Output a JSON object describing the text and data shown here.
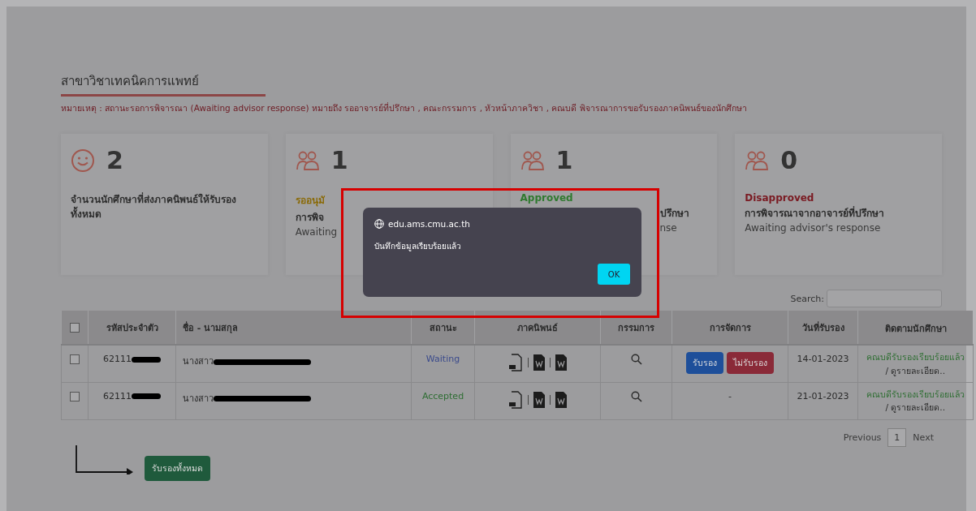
{
  "page": {
    "title": "สาขาวิชาเทคนิคการแพทย์",
    "note": "หมายเหตุ : สถานะรอการพิจารณา (Awaiting advisor response) หมายถึง รออาจารย์ที่ปรึกษา , คณะกรรมการ , หัวหน้าภาควิชา , คณบดี พิจารณาการขอรับรองภาคนิพนธ์ของนักศึกษา"
  },
  "cards": [
    {
      "kind": "smiley",
      "count": "2",
      "description": "จำนวนนักศึกษาที่ส่งภาคนิพนธ์ให้รับรองทั้งหมด"
    },
    {
      "kind": "people",
      "count": "1",
      "label": "รออนุมั",
      "color": "#8a6a08",
      "line_1": "การพิจ",
      "line_2": "Awaiting",
      "hidden_right": true
    },
    {
      "kind": "people",
      "count": "1",
      "label": "Approved",
      "color": "#2f7a2f",
      "line_1": "ปรึกษา",
      "line_2": "nse",
      "hidden_left": true
    },
    {
      "kind": "people",
      "count": "0",
      "label": "Disapproved",
      "color": "#7a1a22",
      "line_1": "การพิจารณาจากอาจารย์ที่ปรึกษา",
      "line_2": "Awaiting advisor's response"
    }
  ],
  "search": {
    "label": "Search:"
  },
  "table": {
    "select_all_checked": false,
    "columns": [
      "รหัสประจำตัว",
      "ชื่อ - นามสกุล",
      "สถานะ",
      "ภาคนิพนธ์",
      "กรรมการ",
      "การจัดการ",
      "วันที่รับรอง",
      "ติดตามนักศึกษา"
    ],
    "rows": [
      {
        "checked": false,
        "id": "62111",
        "name": "นางสาว",
        "status": "Waiting",
        "color": "#3a4a8c",
        "actions": [
          "รับรอง",
          "ไม่รับรอง"
        ],
        "date": "14-01-2023",
        "follow": "คณบดีรับรองเรียบร้อยแล้ว",
        "detail": "/ ดูรายละเอียด.."
      },
      {
        "checked": false,
        "id": "62111",
        "name": "นางสาว",
        "status": "Accepted",
        "color": "#2f6e34",
        "no_action": "-",
        "date": "21-01-2023",
        "follow": "คณบดีรับรองเรียบร้อยแล้ว",
        "detail": "/ ดูรายละเอียด.."
      }
    ]
  },
  "pagination": {
    "previous": "Previous",
    "pages": [
      {
        "label": "1",
        "selected": true
      }
    ],
    "next": "Next"
  },
  "approve_all": "รับรองทั้งหมด",
  "dialog": {
    "origin": "edu.ams.cmu.ac.th",
    "message": "บันทึกข้อมูลเรียบร้อยแล้ว",
    "ok": "OK"
  }
}
